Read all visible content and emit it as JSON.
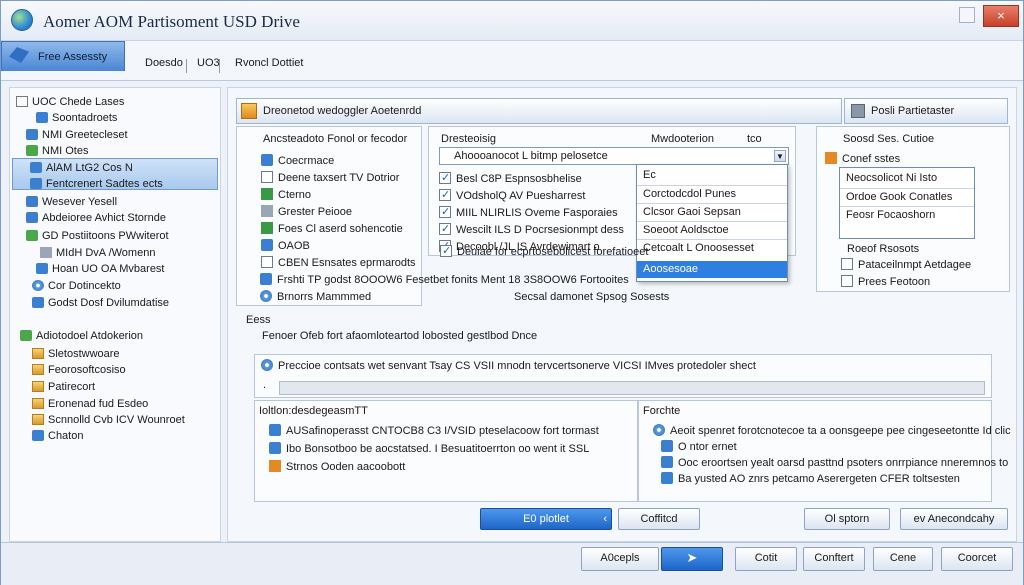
{
  "window": {
    "title": "Aomer AOM Partisoment USD Drive",
    "close_label": "×"
  },
  "menu": {
    "active_tab": "Free Assessty",
    "tab2": "Doesdo",
    "tab3": "UO3",
    "tab4": "Rvoncl Dottiet"
  },
  "tree": {
    "items": [
      "UOC Chede Lases",
      "Soontadroets",
      "NMI Greetecleset",
      "NMI Otes",
      "AlAM LtG2 Cos N",
      "Fentcrenert Sadtes ects",
      "Wesever Yesell",
      "Abdeioree Avhict Stornde",
      "GD Postiitoons PWwiterot",
      "MIdH DvA /Womenn",
      "Hoan UO OA Mvbarest",
      "Cor Dotincekto",
      "Godst Dosf Dvilumdatise",
      "Adiotodoel Atdokerion",
      "Sletostwwoare",
      "Feorosoftcosiso",
      "Patirecort",
      "Eronenad fud Esdeo",
      "Scnnolld Cvb ICV Wounroet",
      "Chaton"
    ]
  },
  "header": {
    "title": "Dreonetod wedoggler Aoetenrdd",
    "right_title": "Posli Partietaster"
  },
  "left_group": {
    "title": "Ancsteadoto Fonol or fecodor",
    "items": [
      "Coecrmace",
      "Deene taxsert TV Dotrior",
      "Cterno",
      "Grester Peiooe",
      "Foes Cl aserd sohencotie",
      "OAOB",
      "CBEN Esnsates eprmarodts"
    ]
  },
  "mid_group": {
    "title": "Dresteoisig",
    "title2": "Mwdooterion",
    "title3": "tco",
    "dropdown_value": "Ahoooanocot L bitmp pelosetce",
    "items": [
      "Besl C8P Espnsosbhelise",
      "VOdsholQ AV Puesharrest",
      "MIIL NLIRLIS Oveme Fasporaies",
      "Wescilt ILS D Pocrsesionmpt dess",
      "Decoobl /JL IS Avrdewimart o",
      "Deuiae for ecprtosebolicest forefatioeet"
    ]
  },
  "popup": {
    "items": [
      "Ec",
      "Corctodcdol Punes",
      "Clcsor Gaoi Sepsan",
      "Soeoot Aoldsctoe",
      "Cetcoalt L Onoosesset",
      "Aoosesoae"
    ]
  },
  "right_group": {
    "title": "Soosd Ses. Cutioe",
    "items": [
      "Conef sstes",
      "Neocsolicot Ni Isto",
      "Ordoe Gook Conatles",
      "Feosr Focaoshorn",
      "Roeof Rsosots",
      "Pataceilnmpt Aetdagee",
      "Prees Feotoon"
    ]
  },
  "options": {
    "line1": "Frshti TP godst 8OOOW6 Fesetbet fonits Ment 18 3S8OOW6 Fortooites",
    "line2a": "Brnorrs Mammmed",
    "line2b": "Secsal damonet Spsog Sosests"
  },
  "section": {
    "title": "Eess",
    "desc": "Fenoer Ofeb fort afaomloteartod lobosted gestlbod Dnce",
    "info": "Preccioe contsats wet senvant Tsay CS VSII mnodn tervcertsonerve VICSI IMves protedoler shect",
    "bullet": "."
  },
  "bottom_left": {
    "title": "Ioltlon:desdegeasmTT",
    "items": [
      "AUSafinoperasst CNTOCB8 C3 I/VSID pteselacoow fort tormast",
      "Ibo Bonsotboo be aocstatsed. I Besuatitoerrton oo went it SSL",
      "Strnos Ooden aacoobott"
    ]
  },
  "bottom_right": {
    "title": "Forchte",
    "items": [
      "Aeoit spenret forotcnotecoe ta a oonsgeepe pee cingeseetontte Id clic",
      "O ntor ernet",
      "Ooc eroortsen yealt oarsd pasttnd psoters onrrpiance nneremnos to",
      "Ba yusted AO znrs petcamo Aserergeten CFER toltsesten"
    ]
  },
  "buttons": {
    "b1": "E0 plotlet",
    "b2": "Coffitcd",
    "b3": "Ol sptorn",
    "b4": "ev Anecondcahy"
  },
  "footer": {
    "f1": "A0cepls",
    "f2": "Cotit",
    "f3": "Conftert",
    "f4": "Cene",
    "f5": "Coorcet"
  }
}
